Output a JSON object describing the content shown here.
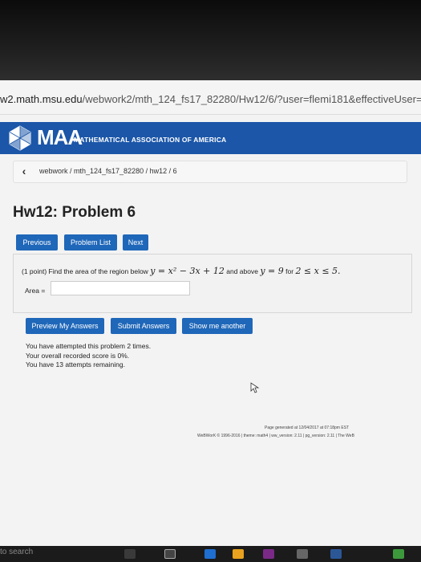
{
  "browser": {
    "url_prefix": "w2.math.msu.edu",
    "url_path": "/webwork2/mth_124_fs17_82280/Hw12/6/?user=flemi181&effectiveUser=fl"
  },
  "brand": {
    "logo_text": "MAA",
    "org_name": "MATHEMATICAL ASSOCIATION OF AMERICA",
    "bar_color": "#1b56a8"
  },
  "breadcrumb": {
    "back_icon": "chevron-left-icon",
    "path": "webwork / mth_124_fs17_82280 / hw12 / 6"
  },
  "page": {
    "title": "Hw12: Problem 6"
  },
  "nav": {
    "previous": "Previous",
    "problem_list": "Problem List",
    "next": "Next"
  },
  "problem": {
    "intro": "(1 point) Find the area of the region below",
    "curve": "y = x² − 3x + 12",
    "and_above": "and above",
    "line": "y = 9",
    "for": "for",
    "interval": "2 ≤ x ≤ 5.",
    "answer_label": "Area =",
    "answer_value": ""
  },
  "actions": {
    "preview": "Preview My Answers",
    "submit": "Submit Answers",
    "show_another": "Show me another"
  },
  "status": {
    "line1": "You have attempted this problem 2 times.",
    "line2": "Your overall recorded score is 0%.",
    "line3": "You have 13 attempts remaining."
  },
  "footer": {
    "generated": "Page generated at 12/04/2017 at 07:18pm EST",
    "version": "WeBWorK © 1996-2016 | theme: math4 | ww_version: 2.11 | pg_version: 2.11 | The WeB"
  },
  "taskbar": {
    "search_text": "to search"
  }
}
